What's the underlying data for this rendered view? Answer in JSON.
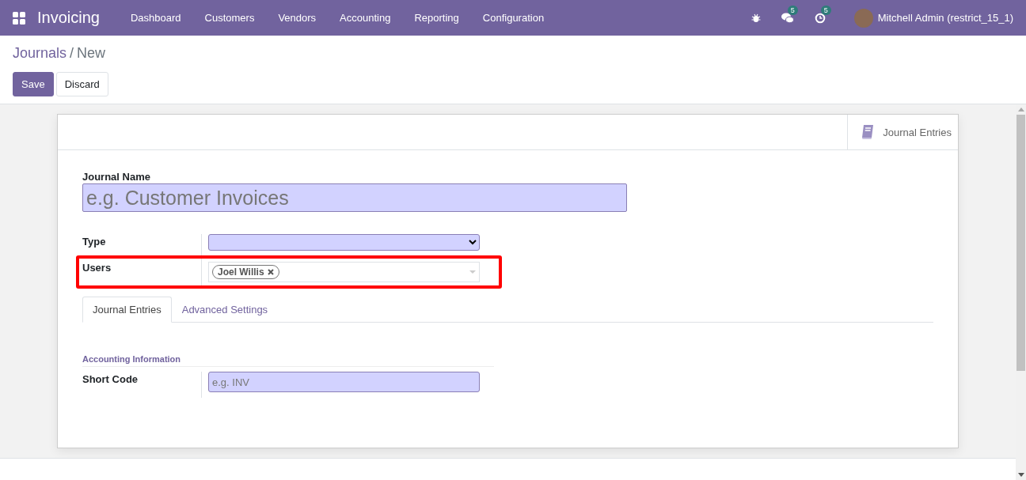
{
  "navbar": {
    "app_name": "Invoicing",
    "menu": [
      "Dashboard",
      "Customers",
      "Vendors",
      "Accounting",
      "Reporting",
      "Configuration"
    ],
    "messages_count": "5",
    "activities_count": "5",
    "user": "Mitchell Admin (restrict_15_1)"
  },
  "breadcrumb": {
    "parent": "Journals",
    "separator": "/",
    "current": "New"
  },
  "buttons": [
    {
      "label": "Save",
      "kind": "primary"
    },
    {
      "label": "Discard",
      "kind": "secondary"
    }
  ],
  "smart_button": {
    "label": "Journal Entries"
  },
  "journal_name": {
    "label": "Journal Name",
    "placeholder": "e.g. Customer Invoices"
  },
  "fields": [
    {
      "label": "Type",
      "kind": "select"
    },
    {
      "label": "Users",
      "kind": "tags",
      "highlighted": true,
      "tags": [
        "Joel Willis"
      ]
    }
  ],
  "tabs": [
    {
      "label": "Journal Entries",
      "selected": true
    },
    {
      "label": "Advanced Settings",
      "selected": false
    }
  ],
  "section": {
    "title": "Accounting Information",
    "fields": [
      {
        "label": "Short Code",
        "placeholder": "e.g. INV"
      }
    ]
  }
}
